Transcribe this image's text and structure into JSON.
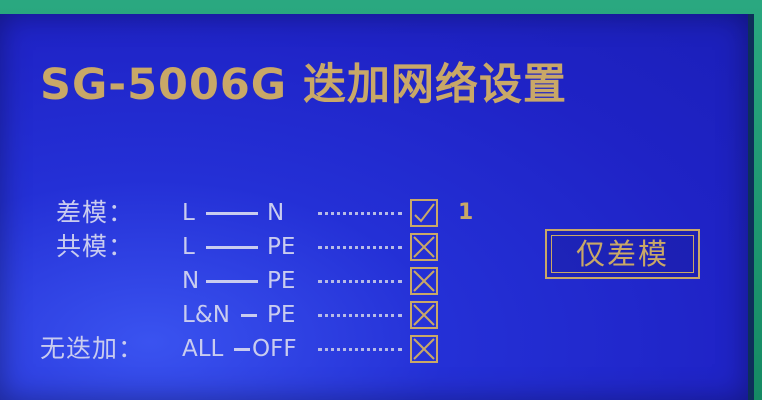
{
  "title": "SG-5006G 迭加网络设置",
  "button_label": "仅差模",
  "colors": {
    "screen_bg": "#1f23c6",
    "accent": "#c9a867",
    "text": "#c9ccef"
  },
  "rows": [
    {
      "label": "差模：",
      "left": "L",
      "right": "N",
      "checked": true,
      "count": "1"
    },
    {
      "label": "共模：",
      "left": "L",
      "right": "PE",
      "checked": false,
      "count": ""
    },
    {
      "label": "",
      "left": "N",
      "right": "PE",
      "checked": false,
      "count": ""
    },
    {
      "label": "",
      "left": "L&N",
      "right": "PE",
      "checked": false,
      "count": ""
    },
    {
      "label": "无迭加：",
      "left": "ALL",
      "right": "OFF",
      "checked": false,
      "count": ""
    }
  ]
}
